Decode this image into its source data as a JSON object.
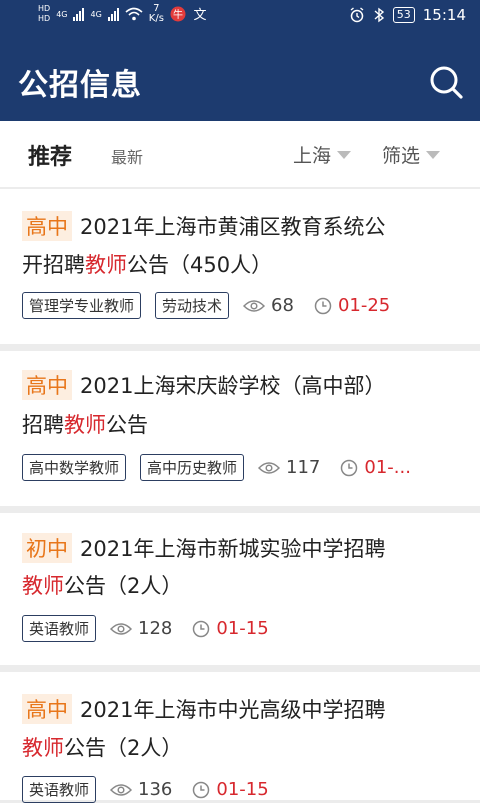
{
  "status_bar": {
    "hd1": "HD",
    "hd2": "HD",
    "net1": "4G",
    "net2": "4G",
    "speed_value": "7",
    "speed_unit": "K/s",
    "battery": "53",
    "time": "15:14"
  },
  "header": {
    "title": "公招信息"
  },
  "tabs": {
    "recommended": "推荐",
    "latest": "最新",
    "region": "上海",
    "filter": "筛选"
  },
  "listings": [
    {
      "level": "高中",
      "title_line1": "2021年上海市黄浦区教育系统公",
      "title_line2_pre": "开招聘",
      "highlight": "教师",
      "title_line2_post": "公告（450人）",
      "tags": [
        "管理学专业教师",
        "劳动技术"
      ],
      "views": "68",
      "date": "01-25"
    },
    {
      "level": "高中",
      "title_line1": "2021上海宋庆龄学校（高中部）",
      "title_line2_pre": "招聘",
      "highlight": "教师",
      "title_line2_post": "公告",
      "tags": [
        "高中数学教师",
        "高中历史教师"
      ],
      "views": "117",
      "date": "01-..."
    },
    {
      "level": "初中",
      "title_line1": "2021年上海市新城实验中学招聘",
      "title_line2_pre": "",
      "highlight": "教师",
      "title_line2_post": "公告（2人）",
      "tags": [
        "英语教师"
      ],
      "views": "128",
      "date": "01-15"
    },
    {
      "level": "高中",
      "title_line1": "2021年上海市中光高级中学招聘",
      "title_line2_pre": "",
      "highlight": "教师",
      "title_line2_post": "公告（2人）",
      "tags": [
        "英语教师"
      ],
      "views": "136",
      "date": "01-15"
    }
  ],
  "colors": {
    "header_bg": "#1d3b6f",
    "level_tag_bg": "#fdeee0",
    "level_tag_text": "#e8761a",
    "highlight": "#d7282e",
    "date": "#d7282e"
  }
}
